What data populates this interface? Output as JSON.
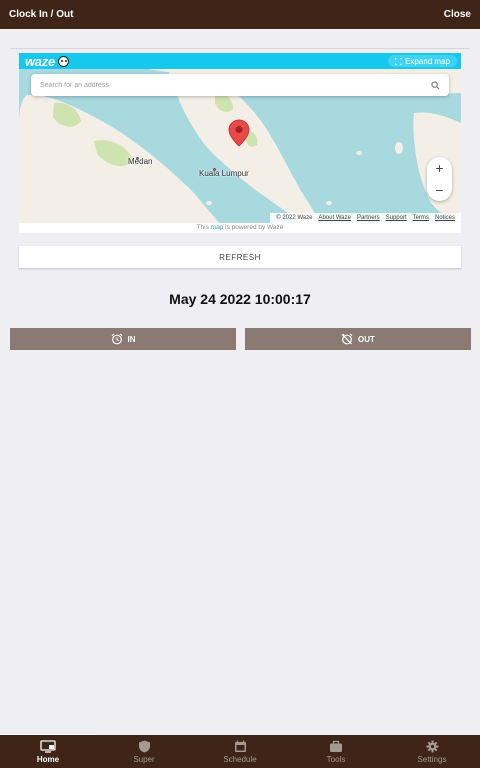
{
  "header": {
    "title": "Clock In / Out",
    "close_label": "Close"
  },
  "map": {
    "brand": "waze",
    "expand_label": "Expand map",
    "search_placeholder": "Search for an address",
    "labels": {
      "city_1": "Medan",
      "city_2": "Kuala Lumpur"
    },
    "zoom_in": "+",
    "zoom_out": "−",
    "footer": {
      "copyright": "© 2022 Waze",
      "about": "About Waze",
      "partners": "Partners",
      "support": "Support",
      "terms": "Terms",
      "notices": "Notices"
    },
    "powered": {
      "prefix": "This",
      "link": "map",
      "suffix": "is powered by Waze"
    }
  },
  "refresh_label": "REFRESH",
  "datetime": "May 24 2022 10:00:17",
  "buttons": {
    "in_label": "IN",
    "out_label": "OUT"
  },
  "tabs": [
    {
      "label": "Home",
      "icon": "home-icon",
      "active": true
    },
    {
      "label": "Super",
      "icon": "shield-icon",
      "active": false
    },
    {
      "label": "Schedule",
      "icon": "calendar-icon",
      "active": false
    },
    {
      "label": "Tools",
      "icon": "briefcase-icon",
      "active": false
    },
    {
      "label": "Settings",
      "icon": "gear-icon",
      "active": false
    }
  ],
  "colors": {
    "header_bg": "#3f2518",
    "clock_button_bg": "#8a7a73",
    "waze_bar": "#16c7ee",
    "page_bg": "#efeef3"
  }
}
